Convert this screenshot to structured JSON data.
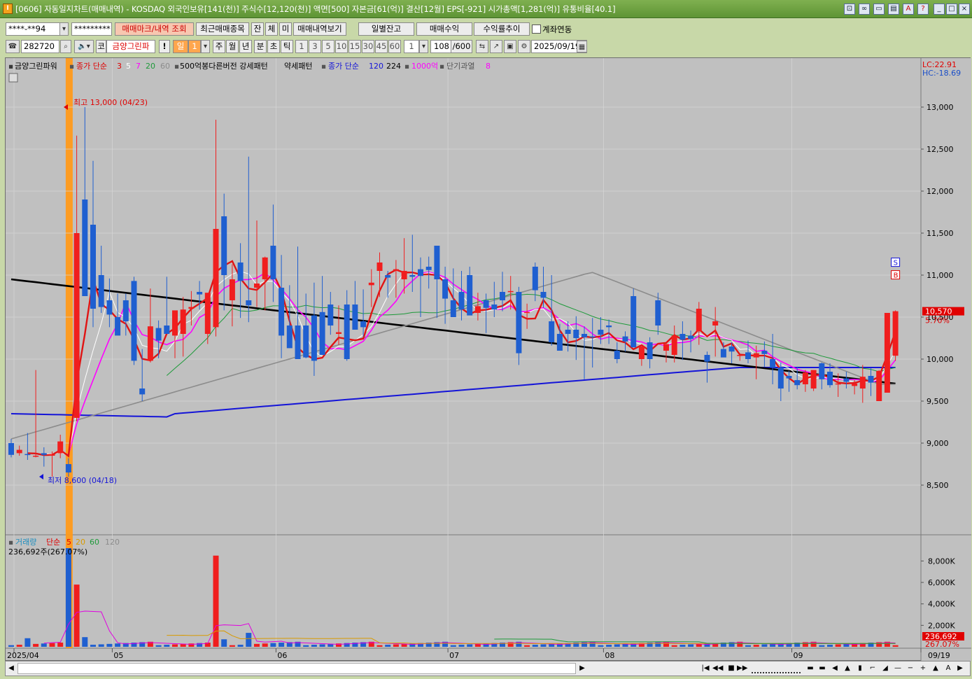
{
  "window": {
    "code_tag": "[0606]",
    "title": "[0606] 자동일지차트(매매내역) - KOSDAQ 외국인보유[141(천)] 주식수[12,120(천)] 액면[500] 자본금[61(억)] 결산[12월] EPS[-921] 시가총액[1,281(억)] 유통비율[40.1]",
    "ctrl_icons": [
      "restore-icon",
      "link-icon",
      "screen-icon",
      "window-icon",
      "font-icon",
      "help-icon",
      "minimize-icon",
      "maximize-icon",
      "close-icon"
    ]
  },
  "toolbar1": {
    "account": "****-**94",
    "password": "*********",
    "btn_trade_mark": "매매마크/내역 조회",
    "btn_recent": "최근매매종목",
    "btn_jan": "잔",
    "btn_che": "체",
    "btn_mi": "미",
    "btn_trade_view": "매매내역보기",
    "btn_daily_balance": "일별잔고",
    "btn_trade_profit": "매매수익",
    "btn_return_trend": "수익률추이",
    "link_label": "계좌연동"
  },
  "toolbar2": {
    "stock_code": "282720",
    "market": "코",
    "stock_name": "금양그린파",
    "excl": "!",
    "period_selected": "일",
    "period_num": "1",
    "periods": [
      "주",
      "월",
      "년",
      "분",
      "초",
      "틱"
    ],
    "minute_opts": [
      "1",
      "3",
      "5",
      "10",
      "15",
      "30",
      "45",
      "60"
    ],
    "tick_val": "1",
    "count_current": "108",
    "count_total": "/600",
    "date": "2025/09/19"
  },
  "legend": {
    "stock": "금양그린파워",
    "close_simple": "종가 단순",
    "ma": [
      "3",
      "5",
      "7",
      "20",
      "60"
    ],
    "pattern1": "500억봉다른버전 강세패턴",
    "pattern2": "약세패턴",
    "close_simple2": "종가 단순",
    "ma2": [
      "120",
      "224"
    ],
    "amt": "1000억",
    "short_over": "단기과열",
    "short_val": "8",
    "lc": "LC:22.91",
    "hc": "HC:-18.69"
  },
  "volume_legend": {
    "label": "거래량",
    "simple": "단순",
    "ma": [
      "5",
      "20",
      "60",
      "120"
    ],
    "value": "236,692주(267.07%)"
  },
  "annotations": {
    "high": "최고 13,000 (04/23)",
    "low": "최저 8,600 (04/18)"
  },
  "markers": {
    "s": "S",
    "b": "B"
  },
  "price_badge": {
    "price": "10,570",
    "pct": "5.70%"
  },
  "volume_badge": {
    "vol": "236,692",
    "pct": "267.07%"
  },
  "colors": {
    "up": "#f01e1e",
    "down": "#1f5fd0",
    "ma3": "#e01414",
    "ma5": "#ffffff",
    "ma7": "#ff00ff",
    "ma20": "#1e9a3a",
    "ma60": "#8c8c8c",
    "ma120": "#1414d8",
    "ma224": "#000000",
    "highlight": "#ff9a1a"
  },
  "chart_data": {
    "type": "candlestick",
    "y_ticks": [
      "13,000",
      "12,500",
      "12,000",
      "11,500",
      "11,000",
      "10,500",
      "10,000",
      "9,500",
      "9,000",
      "8,500"
    ],
    "volume_ticks": [
      "8,000K",
      "6,000K",
      "4,000K",
      "2,000K"
    ],
    "x_labels": [
      "2025/04",
      "05",
      "06",
      "07",
      "08",
      "09",
      "09/19"
    ],
    "ylim": [
      8000,
      13300
    ],
    "candles": [
      {
        "o": 9000,
        "h": 9050,
        "l": 8830,
        "c": 8860
      },
      {
        "o": 8880,
        "h": 8970,
        "l": 8850,
        "c": 8920
      },
      {
        "o": 8870,
        "h": 9120,
        "l": 8800,
        "c": 8860
      },
      {
        "o": 8850,
        "h": 9870,
        "l": 8830,
        "c": 8850
      },
      {
        "o": 8880,
        "h": 8950,
        "l": 8720,
        "c": 8860
      },
      {
        "o": 8850,
        "h": 8900,
        "l": 8600,
        "c": 8870
      },
      {
        "o": 8880,
        "h": 9100,
        "l": 8820,
        "c": 9020
      },
      {
        "o": 8750,
        "h": 8820,
        "l": 8600,
        "c": 8650
      },
      {
        "o": 9300,
        "h": 12660,
        "l": 9260,
        "c": 11500
      },
      {
        "o": 11900,
        "h": 13000,
        "l": 11230,
        "c": 10750
      },
      {
        "o": 11600,
        "h": 12360,
        "l": 10380,
        "c": 10600
      },
      {
        "o": 11000,
        "h": 11350,
        "l": 10550,
        "c": 10620
      },
      {
        "o": 10700,
        "h": 10960,
        "l": 10380,
        "c": 10530
      },
      {
        "o": 10500,
        "h": 10780,
        "l": 10370,
        "c": 10280
      },
      {
        "o": 10700,
        "h": 10780,
        "l": 10280,
        "c": 10450
      },
      {
        "o": 10930,
        "h": 10980,
        "l": 9930,
        "c": 9980
      },
      {
        "o": 9650,
        "h": 10120,
        "l": 9500,
        "c": 9580
      },
      {
        "o": 9980,
        "h": 10840,
        "l": 9960,
        "c": 10390
      },
      {
        "o": 10370,
        "h": 10460,
        "l": 10010,
        "c": 10220
      },
      {
        "o": 10400,
        "h": 10980,
        "l": 10310,
        "c": 10300
      },
      {
        "o": 10280,
        "h": 10420,
        "l": 10010,
        "c": 10580
      },
      {
        "o": 10300,
        "h": 10740,
        "l": 10030,
        "c": 10590
      },
      {
        "o": 10600,
        "h": 10810,
        "l": 10400,
        "c": 10620
      },
      {
        "o": 10800,
        "h": 10930,
        "l": 10590,
        "c": 10770
      },
      {
        "o": 10300,
        "h": 10750,
        "l": 10180,
        "c": 10790
      },
      {
        "o": 10380,
        "h": 12850,
        "l": 10270,
        "c": 11550
      },
      {
        "o": 11700,
        "h": 11970,
        "l": 10580,
        "c": 11000
      },
      {
        "o": 10700,
        "h": 11130,
        "l": 10390,
        "c": 10950
      },
      {
        "o": 11150,
        "h": 11380,
        "l": 10490,
        "c": 10930
      },
      {
        "o": 10700,
        "h": 12410,
        "l": 10440,
        "c": 10640
      },
      {
        "o": 10850,
        "h": 11650,
        "l": 10620,
        "c": 10900
      },
      {
        "o": 10950,
        "h": 11220,
        "l": 10580,
        "c": 11210
      },
      {
        "o": 11350,
        "h": 11840,
        "l": 10680,
        "c": 10950
      },
      {
        "o": 10850,
        "h": 11240,
        "l": 10010,
        "c": 10280
      },
      {
        "o": 10400,
        "h": 10880,
        "l": 10160,
        "c": 10130
      },
      {
        "o": 10400,
        "h": 11340,
        "l": 10090,
        "c": 10000
      },
      {
        "o": 10400,
        "h": 10780,
        "l": 10010,
        "c": 10020
      },
      {
        "o": 10520,
        "h": 10910,
        "l": 9800,
        "c": 9980
      },
      {
        "o": 10560,
        "h": 10990,
        "l": 10260,
        "c": 10050
      },
      {
        "o": 10650,
        "h": 10800,
        "l": 10290,
        "c": 10400
      },
      {
        "o": 10300,
        "h": 10640,
        "l": 10170,
        "c": 10320
      },
      {
        "o": 10650,
        "h": 10820,
        "l": 9980,
        "c": 10000
      },
      {
        "o": 10650,
        "h": 10930,
        "l": 10530,
        "c": 10350
      },
      {
        "o": 10450,
        "h": 10830,
        "l": 10270,
        "c": 10380
      },
      {
        "o": 10880,
        "h": 11070,
        "l": 10620,
        "c": 10910
      },
      {
        "o": 11050,
        "h": 11270,
        "l": 10740,
        "c": 11150
      },
      {
        "o": 11000,
        "h": 11050,
        "l": 10730,
        "c": 10970
      },
      {
        "o": 11050,
        "h": 11180,
        "l": 10730,
        "c": 11070
      },
      {
        "o": 10950,
        "h": 11440,
        "l": 10780,
        "c": 11050
      },
      {
        "o": 11000,
        "h": 11480,
        "l": 10800,
        "c": 10980
      },
      {
        "o": 11070,
        "h": 11210,
        "l": 10500,
        "c": 10990
      },
      {
        "o": 11100,
        "h": 11220,
        "l": 10840,
        "c": 11060
      },
      {
        "o": 11350,
        "h": 11350,
        "l": 10490,
        "c": 10950
      },
      {
        "o": 10950,
        "h": 11100,
        "l": 10420,
        "c": 10720
      },
      {
        "o": 10700,
        "h": 11080,
        "l": 10600,
        "c": 10500
      },
      {
        "o": 10800,
        "h": 11050,
        "l": 10460,
        "c": 10590
      },
      {
        "o": 11000,
        "h": 11100,
        "l": 10550,
        "c": 10520
      },
      {
        "o": 10550,
        "h": 10790,
        "l": 10460,
        "c": 10630
      },
      {
        "o": 10700,
        "h": 10780,
        "l": 10310,
        "c": 10610
      },
      {
        "o": 10650,
        "h": 10920,
        "l": 10500,
        "c": 10590
      },
      {
        "o": 10800,
        "h": 11040,
        "l": 10570,
        "c": 10700
      },
      {
        "o": 10800,
        "h": 10990,
        "l": 10590,
        "c": 10810
      },
      {
        "o": 10800,
        "h": 10860,
        "l": 9930,
        "c": 10070
      },
      {
        "o": 10550,
        "h": 10660,
        "l": 10360,
        "c": 10560
      },
      {
        "o": 11100,
        "h": 11150,
        "l": 10690,
        "c": 10820
      },
      {
        "o": 10800,
        "h": 11100,
        "l": 10610,
        "c": 10730
      },
      {
        "o": 10450,
        "h": 11000,
        "l": 10160,
        "c": 10200
      },
      {
        "o": 10300,
        "h": 10420,
        "l": 10130,
        "c": 10100
      },
      {
        "o": 10350,
        "h": 10450,
        "l": 10090,
        "c": 10300
      },
      {
        "o": 10350,
        "h": 10510,
        "l": 9990,
        "c": 10250
      },
      {
        "o": 10300,
        "h": 10390,
        "l": 9760,
        "c": 10260
      },
      {
        "o": 10270,
        "h": 10490,
        "l": 9900,
        "c": 10260
      },
      {
        "o": 10350,
        "h": 10500,
        "l": 10180,
        "c": 10290
      },
      {
        "o": 10400,
        "h": 10470,
        "l": 10180,
        "c": 10380
      },
      {
        "o": 10100,
        "h": 10200,
        "l": 9950,
        "c": 10000
      },
      {
        "o": 10270,
        "h": 10330,
        "l": 10090,
        "c": 10210
      },
      {
        "o": 10750,
        "h": 10840,
        "l": 10160,
        "c": 10140
      },
      {
        "o": 10000,
        "h": 10040,
        "l": 9920,
        "c": 10150
      },
      {
        "o": 10200,
        "h": 10260,
        "l": 9890,
        "c": 10000
      },
      {
        "o": 10700,
        "h": 10790,
        "l": 10290,
        "c": 10400
      },
      {
        "o": 10100,
        "h": 10170,
        "l": 9960,
        "c": 10180
      },
      {
        "o": 10050,
        "h": 10400,
        "l": 9960,
        "c": 10280
      },
      {
        "o": 10300,
        "h": 10450,
        "l": 9990,
        "c": 10230
      },
      {
        "o": 10280,
        "h": 10340,
        "l": 10080,
        "c": 10240
      },
      {
        "o": 10330,
        "h": 10680,
        "l": 10170,
        "c": 10600
      },
      {
        "o": 10050,
        "h": 10090,
        "l": 9720,
        "c": 9970
      },
      {
        "o": 10400,
        "h": 10620,
        "l": 10030,
        "c": 10450
      },
      {
        "o": 10120,
        "h": 10200,
        "l": 10060,
        "c": 10020
      },
      {
        "o": 10150,
        "h": 10200,
        "l": 9950,
        "c": 10090
      },
      {
        "o": 10050,
        "h": 10060,
        "l": 9980,
        "c": 10050
      },
      {
        "o": 10080,
        "h": 10220,
        "l": 9950,
        "c": 10000
      },
      {
        "o": 10020,
        "h": 10160,
        "l": 9760,
        "c": 10070
      },
      {
        "o": 10100,
        "h": 10210,
        "l": 9910,
        "c": 10060
      },
      {
        "o": 10000,
        "h": 10300,
        "l": 9700,
        "c": 9900
      },
      {
        "o": 9900,
        "h": 9960,
        "l": 9500,
        "c": 9650
      },
      {
        "o": 9800,
        "h": 9860,
        "l": 9610,
        "c": 9770
      },
      {
        "o": 9750,
        "h": 9910,
        "l": 9640,
        "c": 9690
      },
      {
        "o": 9700,
        "h": 9870,
        "l": 9610,
        "c": 9840
      },
      {
        "o": 9650,
        "h": 9860,
        "l": 9620,
        "c": 9870
      },
      {
        "o": 9950,
        "h": 9960,
        "l": 9640,
        "c": 9760
      },
      {
        "o": 9850,
        "h": 9950,
        "l": 9660,
        "c": 9690
      },
      {
        "o": 9700,
        "h": 9830,
        "l": 9550,
        "c": 9710
      },
      {
        "o": 9770,
        "h": 9850,
        "l": 9650,
        "c": 9730
      },
      {
        "o": 9680,
        "h": 9750,
        "l": 9580,
        "c": 9710
      },
      {
        "o": 9650,
        "h": 9930,
        "l": 9480,
        "c": 9790
      },
      {
        "o": 9800,
        "h": 9890,
        "l": 9560,
        "c": 9720
      },
      {
        "o": 9500,
        "h": 9870,
        "l": 9530,
        "c": 9860
      },
      {
        "o": 9600,
        "h": 10190,
        "l": 10000,
        "c": 10550
      },
      {
        "o": 10040,
        "h": 10580,
        "l": 9980,
        "c": 10570
      }
    ]
  }
}
